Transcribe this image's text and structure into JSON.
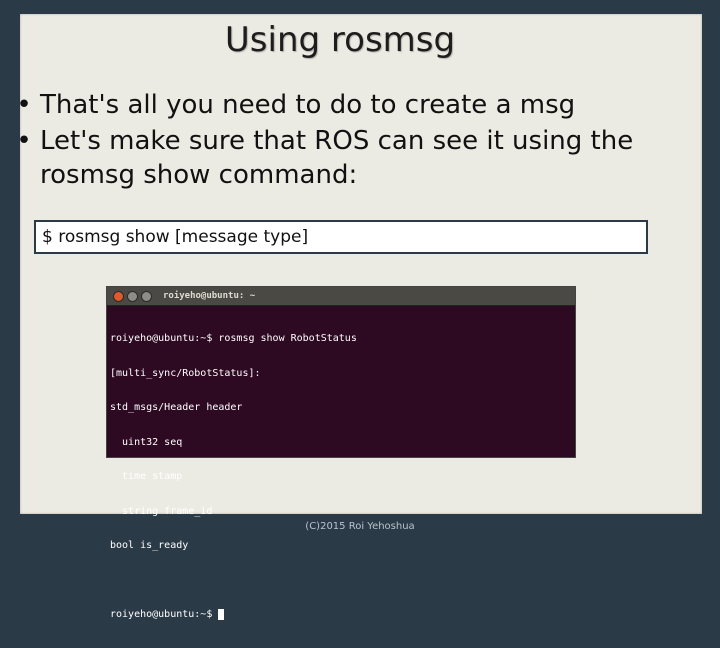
{
  "slide": {
    "title": "Using rosmsg",
    "bullets": [
      "That's all you need to do to create a msg",
      "Let's make sure that ROS can see it using the rosmsg show command:"
    ],
    "bullet_char": "•",
    "command": "$ rosmsg show [message type]"
  },
  "terminal": {
    "title": "roiyeho@ubuntu: ~",
    "lines": [
      "roiyeho@ubuntu:~$ rosmsg show RobotStatus",
      "[multi_sync/RobotStatus]:",
      "std_msgs/Header header",
      "  uint32 seq",
      "  time stamp",
      "  string frame_id",
      "bool is_ready",
      "",
      "roiyeho@ubuntu:~$ "
    ]
  },
  "footer": "(C)2015 Roi Yehoshua"
}
